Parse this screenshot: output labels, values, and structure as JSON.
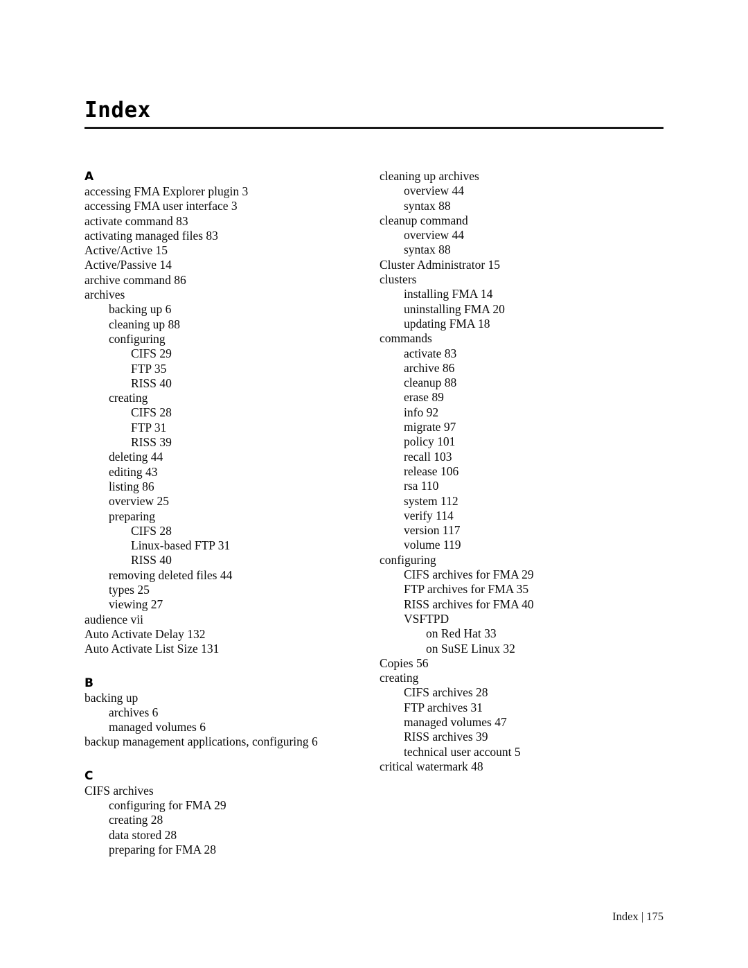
{
  "document": {
    "title": "Index",
    "footer_text": "Index | 175",
    "page_number": "175",
    "accent_rule_color": "#1a1a1a",
    "text_color": "#0a0a0a"
  },
  "columns": {
    "left": [
      {
        "kind": "letter",
        "text": "A"
      },
      {
        "kind": "entry",
        "level": 0,
        "text": "accessing FMA Explorer plugin 3"
      },
      {
        "kind": "entry",
        "level": 0,
        "text": "accessing FMA user interface 3"
      },
      {
        "kind": "entry",
        "level": 0,
        "text": "activate command 83"
      },
      {
        "kind": "entry",
        "level": 0,
        "text": "activating managed files 83"
      },
      {
        "kind": "entry",
        "level": 0,
        "text": "Active/Active 15"
      },
      {
        "kind": "entry",
        "level": 0,
        "text": "Active/Passive 14"
      },
      {
        "kind": "entry",
        "level": 0,
        "text": "archive command 86"
      },
      {
        "kind": "entry",
        "level": 0,
        "text": "archives"
      },
      {
        "kind": "entry",
        "level": 1,
        "text": "backing up 6"
      },
      {
        "kind": "entry",
        "level": 1,
        "text": "cleaning up 88"
      },
      {
        "kind": "entry",
        "level": 1,
        "text": "configuring"
      },
      {
        "kind": "entry",
        "level": 2,
        "text": "CIFS 29"
      },
      {
        "kind": "entry",
        "level": 2,
        "text": "FTP 35"
      },
      {
        "kind": "entry",
        "level": 2,
        "text": "RISS 40"
      },
      {
        "kind": "entry",
        "level": 1,
        "text": "creating"
      },
      {
        "kind": "entry",
        "level": 2,
        "text": "CIFS 28"
      },
      {
        "kind": "entry",
        "level": 2,
        "text": "FTP 31"
      },
      {
        "kind": "entry",
        "level": 2,
        "text": "RISS 39"
      },
      {
        "kind": "entry",
        "level": 1,
        "text": "deleting 44"
      },
      {
        "kind": "entry",
        "level": 1,
        "text": "editing 43"
      },
      {
        "kind": "entry",
        "level": 1,
        "text": "listing 86"
      },
      {
        "kind": "entry",
        "level": 1,
        "text": "overview 25"
      },
      {
        "kind": "entry",
        "level": 1,
        "text": "preparing"
      },
      {
        "kind": "entry",
        "level": 2,
        "text": "CIFS 28"
      },
      {
        "kind": "entry",
        "level": 2,
        "text": "Linux-based FTP 31"
      },
      {
        "kind": "entry",
        "level": 2,
        "text": "RISS 40"
      },
      {
        "kind": "entry",
        "level": 1,
        "text": "removing deleted files 44"
      },
      {
        "kind": "entry",
        "level": 1,
        "text": "types 25"
      },
      {
        "kind": "entry",
        "level": 1,
        "text": "viewing 27"
      },
      {
        "kind": "entry",
        "level": 0,
        "text": "audience vii"
      },
      {
        "kind": "entry",
        "level": 0,
        "text": "Auto Activate Delay 132"
      },
      {
        "kind": "entry",
        "level": 0,
        "text": "Auto Activate List Size 131"
      },
      {
        "kind": "gap"
      },
      {
        "kind": "letter",
        "text": "B"
      },
      {
        "kind": "entry",
        "level": 0,
        "text": "backing up"
      },
      {
        "kind": "entry",
        "level": 1,
        "text": "archives 6"
      },
      {
        "kind": "entry",
        "level": 1,
        "text": "managed volumes 6"
      },
      {
        "kind": "entry",
        "level": 0,
        "text": "backup management applications, configuring 6"
      },
      {
        "kind": "gap"
      },
      {
        "kind": "letter",
        "text": "C"
      },
      {
        "kind": "entry",
        "level": 0,
        "text": "CIFS archives"
      },
      {
        "kind": "entry",
        "level": 1,
        "text": "configuring for FMA 29"
      },
      {
        "kind": "entry",
        "level": 1,
        "text": "creating 28"
      },
      {
        "kind": "entry",
        "level": 1,
        "text": "data stored 28"
      },
      {
        "kind": "entry",
        "level": 1,
        "text": "preparing for FMA 28"
      }
    ],
    "right": [
      {
        "kind": "entry",
        "level": 0,
        "text": "cleaning up archives"
      },
      {
        "kind": "entry",
        "level": 1,
        "text": "overview 44"
      },
      {
        "kind": "entry",
        "level": 1,
        "text": "syntax 88"
      },
      {
        "kind": "entry",
        "level": 0,
        "text": "cleanup command"
      },
      {
        "kind": "entry",
        "level": 1,
        "text": "overview 44"
      },
      {
        "kind": "entry",
        "level": 1,
        "text": "syntax 88"
      },
      {
        "kind": "entry",
        "level": 0,
        "text": "Cluster Administrator 15"
      },
      {
        "kind": "entry",
        "level": 0,
        "text": "clusters"
      },
      {
        "kind": "entry",
        "level": 1,
        "text": "installing FMA 14"
      },
      {
        "kind": "entry",
        "level": 1,
        "text": "uninstalling FMA 20"
      },
      {
        "kind": "entry",
        "level": 1,
        "text": "updating FMA 18"
      },
      {
        "kind": "entry",
        "level": 0,
        "text": "commands"
      },
      {
        "kind": "entry",
        "level": 1,
        "text": "activate 83"
      },
      {
        "kind": "entry",
        "level": 1,
        "text": "archive 86"
      },
      {
        "kind": "entry",
        "level": 1,
        "text": "cleanup 88"
      },
      {
        "kind": "entry",
        "level": 1,
        "text": "erase 89"
      },
      {
        "kind": "entry",
        "level": 1,
        "text": "info 92"
      },
      {
        "kind": "entry",
        "level": 1,
        "text": "migrate 97"
      },
      {
        "kind": "entry",
        "level": 1,
        "text": "policy 101"
      },
      {
        "kind": "entry",
        "level": 1,
        "text": "recall 103"
      },
      {
        "kind": "entry",
        "level": 1,
        "text": "release 106"
      },
      {
        "kind": "entry",
        "level": 1,
        "text": "rsa 110"
      },
      {
        "kind": "entry",
        "level": 1,
        "text": "system 112"
      },
      {
        "kind": "entry",
        "level": 1,
        "text": "verify 114"
      },
      {
        "kind": "entry",
        "level": 1,
        "text": "version 117"
      },
      {
        "kind": "entry",
        "level": 1,
        "text": "volume 119"
      },
      {
        "kind": "entry",
        "level": 0,
        "text": "configuring"
      },
      {
        "kind": "entry",
        "level": 1,
        "text": "CIFS archives for FMA 29"
      },
      {
        "kind": "entry",
        "level": 1,
        "text": "FTP archives for FMA 35"
      },
      {
        "kind": "entry",
        "level": 1,
        "text": "RISS archives for FMA 40"
      },
      {
        "kind": "entry",
        "level": 1,
        "text": "VSFTPD"
      },
      {
        "kind": "entry",
        "level": 2,
        "text": "on Red Hat 33"
      },
      {
        "kind": "entry",
        "level": 2,
        "text": "on SuSE Linux 32"
      },
      {
        "kind": "entry",
        "level": 0,
        "text": "Copies 56"
      },
      {
        "kind": "entry",
        "level": 0,
        "text": "creating"
      },
      {
        "kind": "entry",
        "level": 1,
        "text": "CIFS archives 28"
      },
      {
        "kind": "entry",
        "level": 1,
        "text": "FTP archives 31"
      },
      {
        "kind": "entry",
        "level": 1,
        "text": "managed volumes 47"
      },
      {
        "kind": "entry",
        "level": 1,
        "text": "RISS archives 39"
      },
      {
        "kind": "entry",
        "level": 1,
        "text": "technical user account 5"
      },
      {
        "kind": "entry",
        "level": 0,
        "text": "critical watermark 48"
      }
    ]
  }
}
